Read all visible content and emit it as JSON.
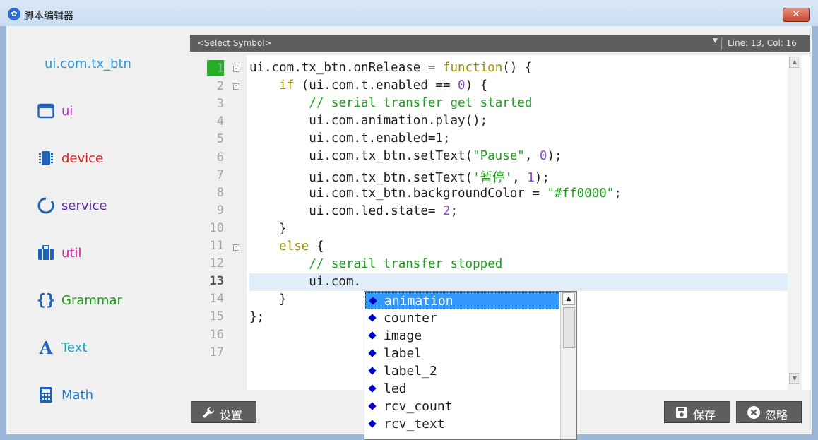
{
  "window": {
    "title": "脚本编辑器",
    "close_glyph": "✕"
  },
  "sidebar": {
    "header": "ui.com.tx_btn",
    "items": [
      {
        "label": "ui",
        "icon": "window-icon",
        "color": "#c51ec8"
      },
      {
        "label": "device",
        "icon": "chip-icon",
        "color": "#e02020"
      },
      {
        "label": "service",
        "icon": "ring-icon",
        "color": "#5a2d9c"
      },
      {
        "label": "util",
        "icon": "briefcase-icon",
        "color": "#d01fa0"
      },
      {
        "label": "Grammar",
        "icon": "braces-icon",
        "color": "#1b9e1b"
      },
      {
        "label": "Text",
        "icon": "letter-a-icon",
        "color": "#1a9fb8"
      },
      {
        "label": "Math",
        "icon": "calculator-icon",
        "color": "#1a7fd0"
      }
    ],
    "icon_color": "#1f63b9"
  },
  "symbol_bar": {
    "select_label": "<Select Symbol>",
    "dropdown_arrow": "▼",
    "position": "Line: 13, Col: 16"
  },
  "editor": {
    "line_numbers": [
      "1",
      "2",
      "3",
      "4",
      "5",
      "6",
      "7",
      "8",
      "9",
      "10",
      "11",
      "12",
      "13",
      "14",
      "15",
      "16",
      "17"
    ],
    "current_line": 13,
    "lines": [
      [
        "ui.com.tx_btn.onRelease = ",
        "function",
        "() {"
      ],
      [
        "    ",
        "if",
        " (ui.com.t.enabled == ",
        "0",
        ") {"
      ],
      [
        "        ",
        "// serial transfer get started"
      ],
      [
        "        ui.com.animation.play();"
      ],
      [
        "        ui.com.t.enabled=1;"
      ],
      [
        "        ui.com.tx_btn.setText(",
        "\"Pause\"",
        ", ",
        "0",
        ");"
      ],
      [
        "        ui.com.tx_btn.setText(",
        "'暂停'",
        ", ",
        "1",
        ");"
      ],
      [
        "        ui.com.tx_btn.backgroundColor = ",
        "\"#ff0000\"",
        ";"
      ],
      [
        "        ui.com.led.state= ",
        "2",
        ";"
      ],
      [
        "    }"
      ],
      [
        "    ",
        "else",
        " {"
      ],
      [
        "        ",
        "// serail transfer stopped"
      ],
      [
        "        ui.com."
      ],
      [
        "    }"
      ],
      [
        "};"
      ],
      [
        ""
      ],
      [
        ""
      ]
    ],
    "colors": {
      "keyword": "#9e8f00",
      "comment": "#1e9e1e",
      "string": "#1e9e1e",
      "number": "#8a4fc4"
    }
  },
  "autocomplete": {
    "items": [
      "animation",
      "counter",
      "image",
      "label",
      "label_2",
      "led",
      "rcv_count",
      "rcv_text"
    ],
    "selected_index": 0
  },
  "buttons": {
    "settings": "设置",
    "save": "保存",
    "ignore": "忽略"
  }
}
